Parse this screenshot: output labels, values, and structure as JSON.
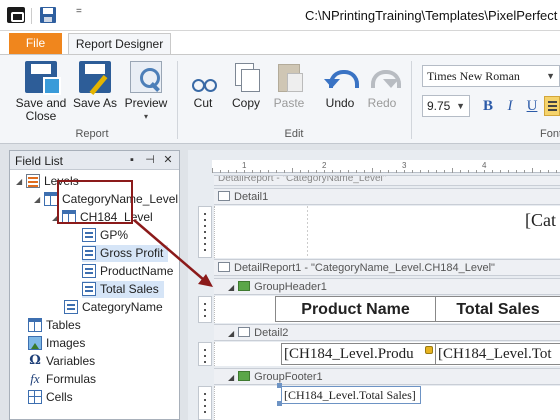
{
  "window": {
    "title": "C:\\NPrintingTraining\\Templates\\PixelPerfect Re",
    "qa_dropdown": "="
  },
  "tabs": [
    {
      "label": "File"
    },
    {
      "label": "Report Designer"
    }
  ],
  "ribbon": {
    "groups": [
      {
        "label": "Report"
      },
      {
        "label": "Edit"
      },
      {
        "label": "Font"
      }
    ],
    "buttons": {
      "save_and_close": "Save and Close",
      "save_as": "Save As",
      "preview": "Preview",
      "cut": "Cut",
      "copy": "Copy",
      "paste": "Paste",
      "undo": "Undo",
      "redo": "Redo"
    },
    "font": {
      "name": "Times New Roman",
      "size": "9.75",
      "bold": "B",
      "italic": "I",
      "underline": "U"
    }
  },
  "field_list": {
    "title": "Field List",
    "buttons": [
      "▪",
      "⊣",
      "✕"
    ],
    "items": [
      {
        "label": "Levels"
      },
      {
        "label": "CategoryName_Level"
      },
      {
        "label": "CH184_Level"
      },
      {
        "label": "GP%"
      },
      {
        "label": "Gross Profit"
      },
      {
        "label": "ProductName"
      },
      {
        "label": "Total Sales"
      },
      {
        "label": "CategoryName"
      },
      {
        "label": "Tables"
      },
      {
        "label": "Images"
      },
      {
        "label": "Variables"
      },
      {
        "label": "Formulas"
      },
      {
        "label": "Cells"
      }
    ]
  },
  "designer": {
    "ruler_numbers": [
      "1",
      "2",
      "3",
      "4"
    ],
    "bands": {
      "detail_report_top": "DetailReport - \"CategoryName_Level\"",
      "detail1": "Detail1",
      "detail_report1": "DetailReport1 - \"CategoryName_Level.CH184_Level\"",
      "group_header1": "GroupHeader1",
      "detail2": "Detail2",
      "group_footer1": "GroupFooter1"
    },
    "cells": {
      "category_partial": "[Cat",
      "header_product_name": "Product Name",
      "header_total_sales": "Total Sales",
      "data_product": "[CH184_Level.Produ",
      "data_total": "[CH184_Level.Tot",
      "footer_total": "[CH184_Level.Total Sales]"
    }
  },
  "annotation_color": "#8b1a1a",
  "accent_color": "#f0861d"
}
